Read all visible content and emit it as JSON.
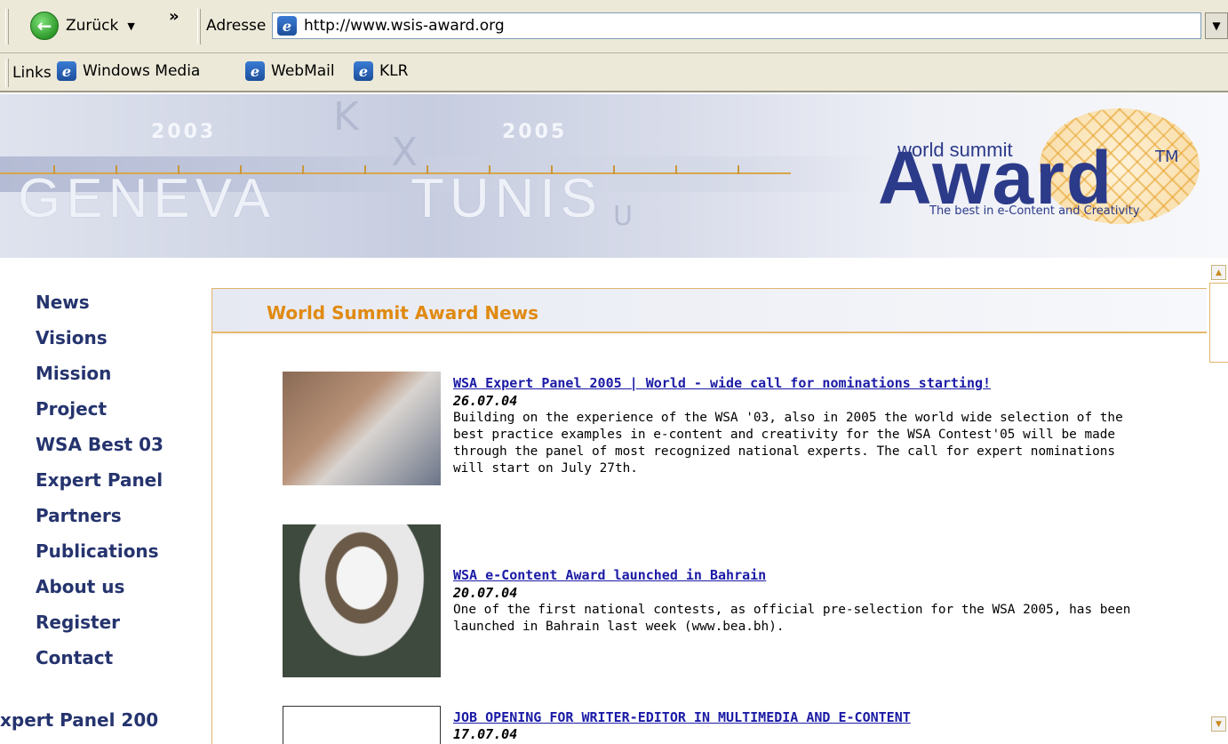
{
  "browser": {
    "back_label": "Zurück",
    "chevron": "»",
    "address_label": "Adresse",
    "url": "http://www.wsis-award.org",
    "links_label": "Links",
    "links": [
      "Windows Media",
      "WebMail",
      "KLR"
    ]
  },
  "banner": {
    "year_left": "2003",
    "year_right": "2005",
    "city_left": "GENEVA",
    "city_right": "TUNIS",
    "logo_small": "world summit",
    "logo_big": "Award",
    "logo_tm": "TM",
    "logo_tagline": "The best in e-Content and Creativity"
  },
  "nav": {
    "items": [
      "News",
      "Visions",
      "Mission",
      "Project",
      "WSA Best 03",
      "Expert Panel",
      "Partners",
      "Publications",
      "About us",
      "Register",
      "Contact"
    ],
    "ticker": "xpert Panel 200"
  },
  "news": {
    "heading": "World Summit Award News",
    "items": [
      {
        "title": "WSA Expert Panel 2005 | World - wide call for nominations starting!",
        "date": "26.07.04",
        "body": "Building on the experience of the WSA '03, also in 2005 the world wide selection of the best practice examples in e-content and creativity for the WSA Contest'05 will be made through the panel of most recognized national experts. The call for expert nominations will start on July 27th."
      },
      {
        "title": "WSA e-Content Award launched in Bahrain",
        "date": "20.07.04",
        "body": "One of the first national contests, as official pre-selection for the WSA 2005, has been launched in Bahrain last week (www.bea.bh)."
      },
      {
        "title": "JOB OPENING FOR WRITER-EDITOR IN MULTIMEDIA AND E-CONTENT",
        "date": "17.07.04",
        "body": ""
      }
    ]
  },
  "icons": {
    "back": "back-arrow-icon",
    "ie": "internet-explorer-icon"
  }
}
